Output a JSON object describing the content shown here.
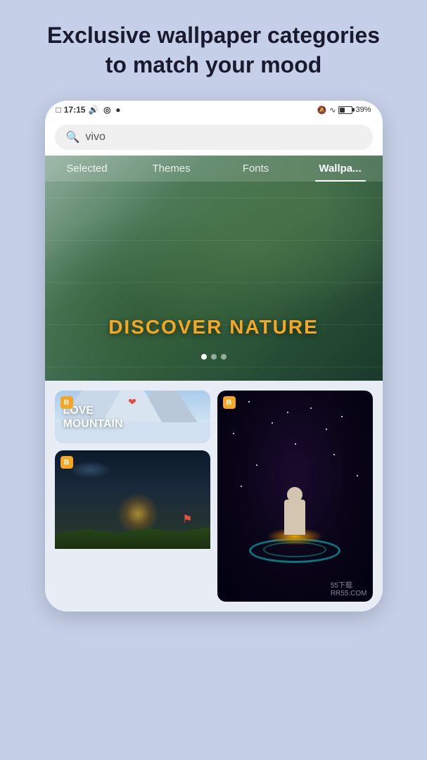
{
  "headline": "Exclusive wallpaper categories to match your mood",
  "statusBar": {
    "time": "17:15",
    "batteryPercent": "39%",
    "icons": [
      "notification-bell",
      "wifi-icon",
      "battery-icon"
    ]
  },
  "searchBar": {
    "placeholder": "vivo",
    "value": "vivo"
  },
  "tabs": [
    {
      "label": "Selected",
      "active": false
    },
    {
      "label": "Themes",
      "active": false
    },
    {
      "label": "Fonts",
      "active": false
    },
    {
      "label": "Wallpa...",
      "active": true
    }
  ],
  "heroBanner": {
    "title": "DISCOVER NATURE"
  },
  "wallpapers": [
    {
      "label": "LOVE\nMOUNTAIN",
      "type": "mountain",
      "badge": "B"
    },
    {
      "label": "",
      "type": "space-anime",
      "badge": "B"
    },
    {
      "label": "",
      "type": "landscape",
      "badge": "B"
    }
  ],
  "watermark": "55下载\nRR55.COM"
}
